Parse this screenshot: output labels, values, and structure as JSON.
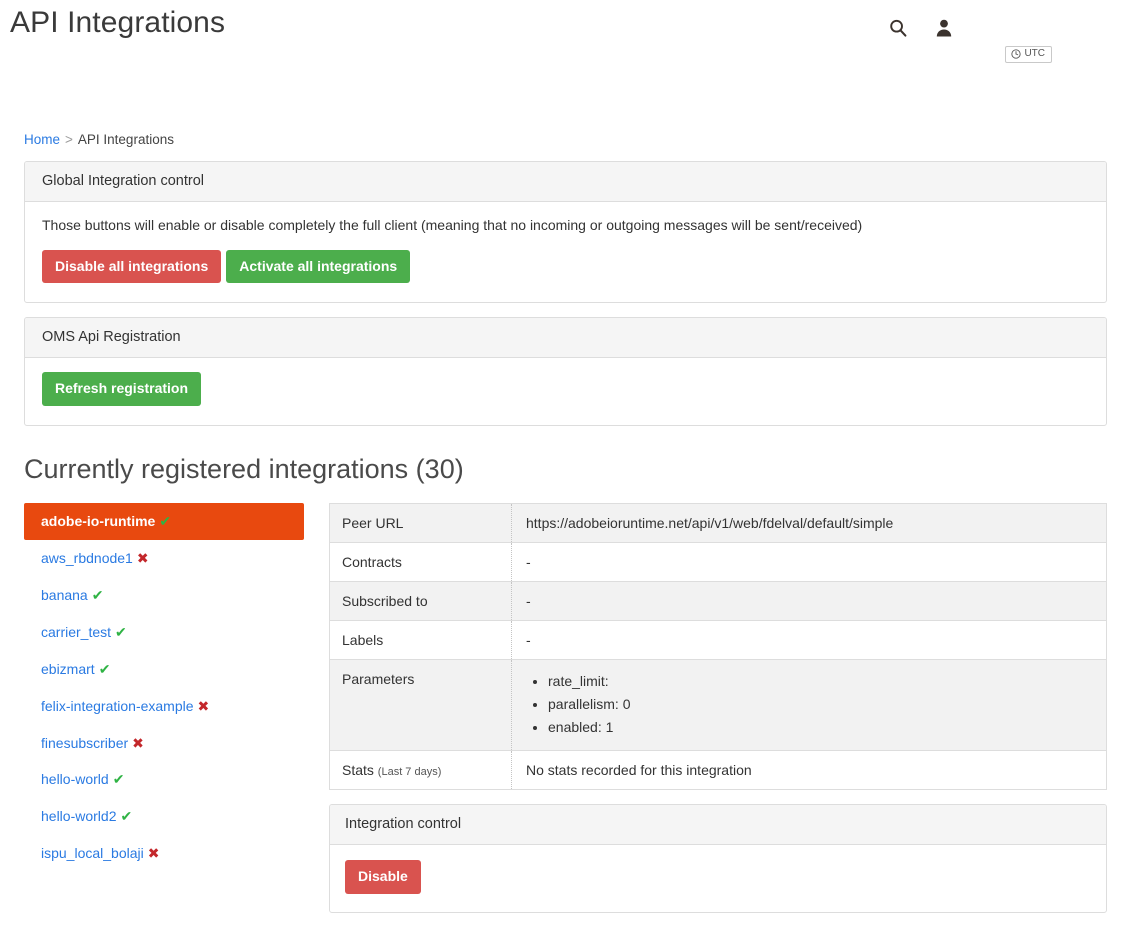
{
  "header": {
    "title": "API Integrations",
    "search_icon": "search-icon",
    "user_icon": "user-icon",
    "utc_badge": {
      "icon": "clock-icon",
      "label": "UTC"
    }
  },
  "breadcrumb": {
    "home": "Home",
    "separator": ">",
    "current": "API Integrations"
  },
  "global_panel": {
    "heading": "Global Integration control",
    "description": "Those buttons will enable or disable completely the full client (meaning that no incoming or outgoing messages will be sent/received)",
    "disable_all_label": "Disable all integrations",
    "activate_all_label": "Activate all integrations",
    "danger_color": "#d9534f",
    "success_color": "#4cae4c"
  },
  "oms_panel": {
    "heading": "OMS Api Registration",
    "refresh_label": "Refresh registration"
  },
  "section": {
    "title": "Currently registered integrations (30)",
    "count": 30
  },
  "integrations": [
    {
      "name": "adobe-io-runtime",
      "status": "ok",
      "active": true
    },
    {
      "name": "aws_rbdnode1",
      "status": "bad",
      "active": false
    },
    {
      "name": "banana",
      "status": "ok",
      "active": false
    },
    {
      "name": "carrier_test",
      "status": "ok",
      "active": false
    },
    {
      "name": "ebizmart",
      "status": "ok",
      "active": false
    },
    {
      "name": "felix-integration-example",
      "status": "bad",
      "active": false
    },
    {
      "name": "finesubscriber",
      "status": "bad",
      "active": false
    },
    {
      "name": "hello-world",
      "status": "ok",
      "active": false
    },
    {
      "name": "hello-world2",
      "status": "ok",
      "active": false
    },
    {
      "name": "ispu_local_bolaji",
      "status": "bad",
      "active": false
    }
  ],
  "status_marks": {
    "ok": "✔",
    "bad": "✖",
    "ok_color": "#2fb344",
    "bad_color": "#c3272b"
  },
  "detail": {
    "rows": [
      {
        "label": "Peer URL",
        "value": "https://adobeioruntime.net/api/v1/web/fdelval/default/simple"
      },
      {
        "label": "Contracts",
        "value": "-"
      },
      {
        "label": "Subscribed to",
        "value": "-"
      },
      {
        "label": "Labels",
        "value": "-"
      }
    ],
    "parameters": {
      "label": "Parameters",
      "items": [
        "rate_limit:",
        "parallelism: 0",
        "enabled: 1"
      ]
    },
    "stats": {
      "label": "Stats",
      "label_note": "(Last 7 days)",
      "value": "No stats recorded for this integration"
    }
  },
  "integration_control": {
    "heading": "Integration control",
    "disable_label": "Disable"
  },
  "theme": {
    "active_item_bg": "#e8490f",
    "link_color": "#2a7ae2",
    "panel_header_bg": "#f5f5f5",
    "border_color": "#dddddd",
    "table_stripe_bg": "#f2f2f2"
  }
}
